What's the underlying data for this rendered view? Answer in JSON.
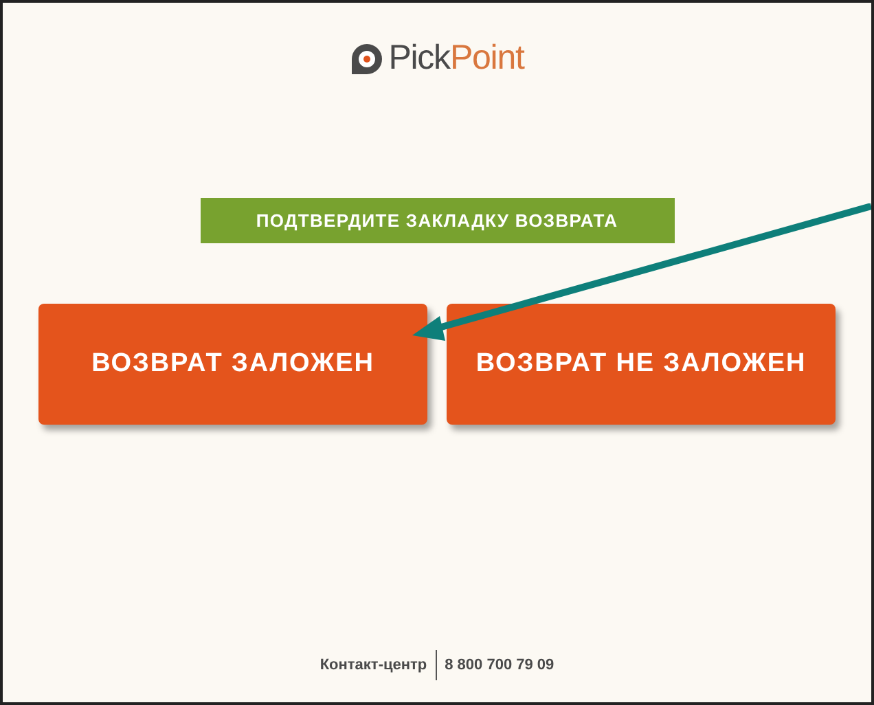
{
  "logo": {
    "dark_part": "Pick",
    "accent_part": "Point"
  },
  "banner": "ПОДТВЕРДИТЕ ЗАКЛАДКУ ВОЗВРАТА",
  "buttons": [
    {
      "label": "ВОЗВРАТ ЗАЛОЖЕН"
    },
    {
      "label": "ВОЗВРАТ НЕ ЗАЛОЖЕН"
    }
  ],
  "footer": {
    "label": "Контакт-центр",
    "phone": "8 800 700 79 09"
  }
}
